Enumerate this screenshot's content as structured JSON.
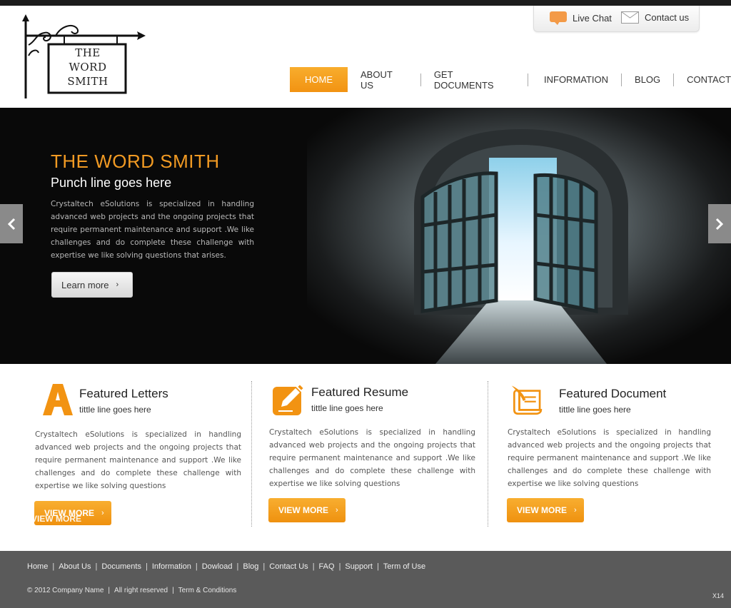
{
  "logo": {
    "line1": "THE",
    "line2": "WORD",
    "line3": "SMITH"
  },
  "utility": {
    "live_chat": "Live Chat",
    "contact_us": "Contact us",
    "chat_icon": "chat-bubble-icon",
    "mail_icon": "envelope-icon"
  },
  "nav": {
    "items": [
      {
        "label": "HOME",
        "active": true
      },
      {
        "label": "ABOUT US"
      },
      {
        "label": "GET DOCUMENTS"
      },
      {
        "label": "INFORMATION"
      },
      {
        "label": "BLOG"
      },
      {
        "label": "CONTACT"
      }
    ]
  },
  "hero": {
    "title": "THE WORD SMITH",
    "subtitle": "Punch line goes here",
    "body": "Crystaltech eSolutions is specialized in handling advanced web projects and the ongoing projects that require permanent maintenance and support .We like challenges and do complete these challenge with expertise we like solving questions that arises.",
    "button": "Learn more",
    "chevron": "›",
    "prev_icon": "chevron-left-icon",
    "next_icon": "chevron-right-icon"
  },
  "features": [
    {
      "title": "Featured Letters",
      "subtitle": "tittle line goes here",
      "body": "Crystaltech eSolutions is specialized in handling advanced web projects and the ongoing projects that require permanent maintenance and support .We like challenges and do complete these challenge with expertise we like solving questions",
      "button": "VIEW MORE",
      "ghost_text": "VIEW MORE",
      "icon": "letter-a-icon"
    },
    {
      "title": "Featured Resume",
      "subtitle": "tittle line goes here",
      "body": "Crystaltech eSolutions is specialized in handling advanced web projects and the ongoing projects that require permanent maintenance and support .We like challenges and do complete these challenge with expertise we like solving questions",
      "button": "VIEW MORE",
      "icon": "pencil-edit-icon"
    },
    {
      "title": "Featured Document",
      "subtitle": "tittle line goes here",
      "body": "Crystaltech eSolutions is specialized in handling advanced web projects and the ongoing projects that require permanent maintenance and support .We like challenges and do complete these challenge with expertise we like solving questions",
      "button": "VIEW MORE",
      "icon": "scroll-quill-icon"
    }
  ],
  "footer": {
    "links": [
      "Home",
      "About Us",
      "Documents",
      "Information",
      "Dowload",
      "Blog",
      "Contact Us",
      "FAQ",
      "Support",
      "Term of Use"
    ],
    "copyright": "© 2012 Company Name",
    "rights": "All right reserved",
    "terms": "Term & Conditions",
    "badge": "X14"
  },
  "colors": {
    "accent": "#f29312",
    "hero_bg": "#090909",
    "footer_bg": "#5a5a5a"
  }
}
